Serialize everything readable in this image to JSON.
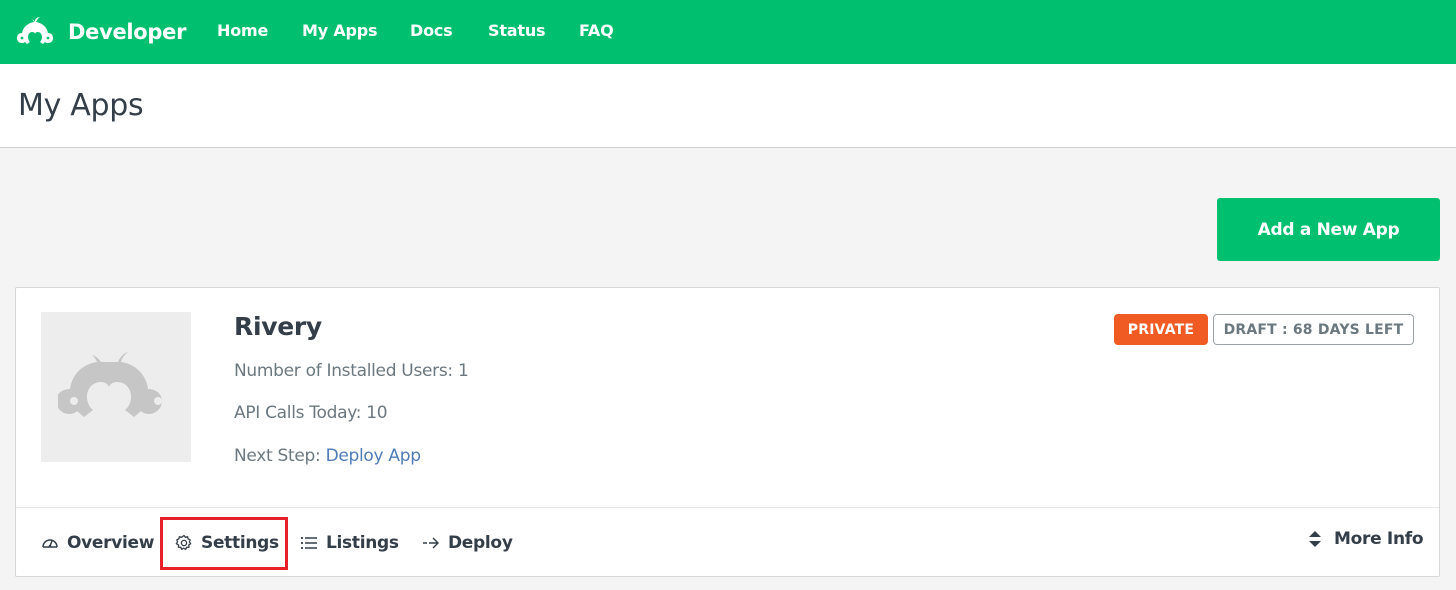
{
  "header": {
    "brand": "Developer",
    "nav": [
      {
        "label": "Home"
      },
      {
        "label": "My Apps"
      },
      {
        "label": "Docs"
      },
      {
        "label": "Status"
      },
      {
        "label": "FAQ"
      }
    ]
  },
  "page": {
    "title": "My Apps",
    "add_button_label": "Add a New App"
  },
  "app": {
    "name": "Rivery",
    "logo_icon": "monkey-logo-placeholder",
    "installed_users_label": "Number of Installed Users:",
    "installed_users_value": "1",
    "api_calls_label": "API Calls Today:",
    "api_calls_value": "10",
    "next_step_label": "Next Step:",
    "next_step_link": "Deploy App",
    "badges": {
      "visibility": "PRIVATE",
      "draft": "DRAFT : 68 DAYS LEFT"
    },
    "tabs": [
      {
        "label": "Overview",
        "icon": "dashboard-gauge-icon"
      },
      {
        "label": "Settings",
        "icon": "gear-icon",
        "highlighted": true
      },
      {
        "label": "Listings",
        "icon": "list-icon"
      },
      {
        "label": "Deploy",
        "icon": "arrow-right-icon"
      }
    ],
    "more_info_label": "More Info"
  },
  "colors": {
    "brand_green": "#00bf6f",
    "private_orange": "#f05b24",
    "link_blue": "#507cb6",
    "highlight_red": "#e8202a"
  }
}
